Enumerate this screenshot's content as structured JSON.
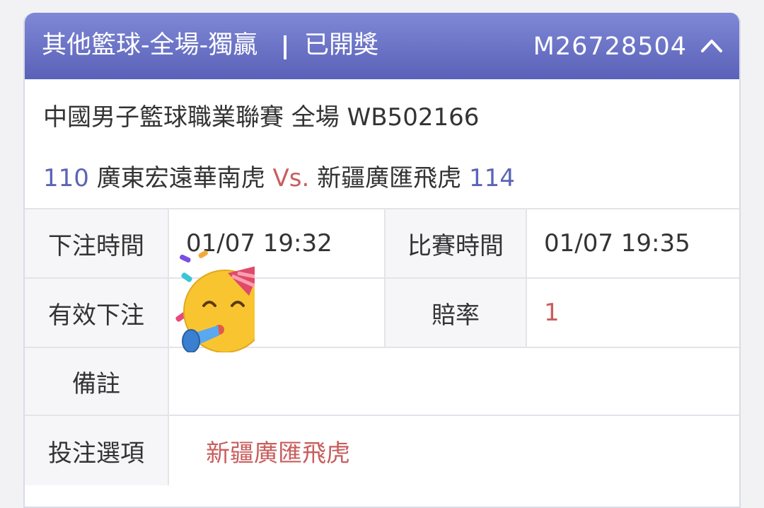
{
  "header": {
    "title": "其他籃球-全場-獨贏",
    "status": "已開獎",
    "ticket_id": "M26728504",
    "chevron_icon": "chevron-up-icon"
  },
  "match": {
    "league_line": "中國男子籃球職業聯賽 全場 WB502166",
    "home_score": "110",
    "home_team": "廣東宏遠華南虎",
    "vs": "Vs.",
    "away_team": "新疆廣匯飛虎",
    "away_score": "114"
  },
  "details": {
    "bet_time_label": "下注時間",
    "bet_time_value": "01/07 19:32",
    "match_time_label": "比賽時間",
    "match_time_value": "01/07 19:35",
    "valid_bet_label": "有效下注",
    "odds_label": "賠率",
    "odds_value": "1",
    "remark_label": "備註",
    "selection_label": "投注選項",
    "selection_value": "新疆廣匯飛虎"
  },
  "overlay": {
    "emoji_icon": "party-face-emoji-icon"
  },
  "colors": {
    "header_top": "#7f88d6",
    "header_bottom": "#5a61b8",
    "score_blue": "#5a65b5",
    "accent_red": "#c85e5e"
  }
}
